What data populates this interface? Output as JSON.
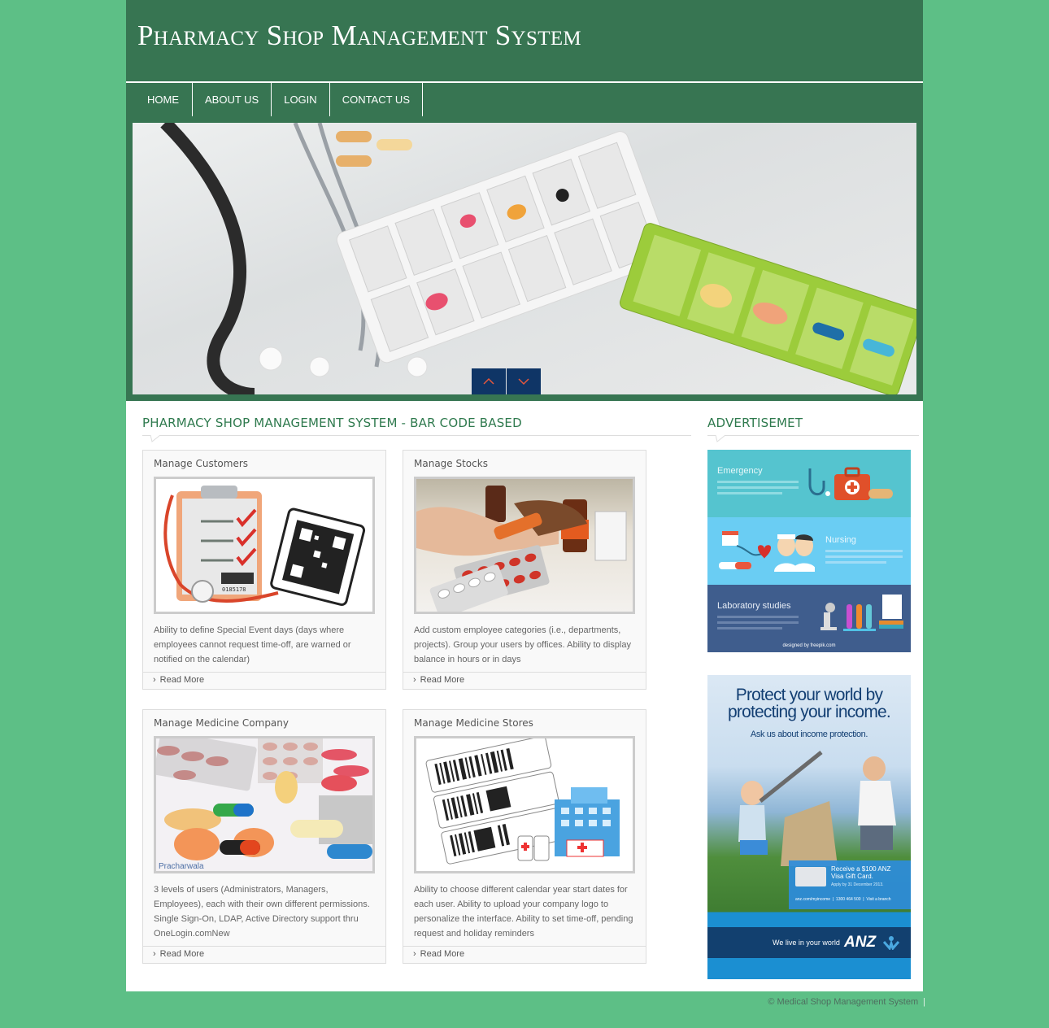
{
  "header": {
    "site_title": "Pharmacy Shop Management System"
  },
  "nav": {
    "items": [
      {
        "label": "HOME"
      },
      {
        "label": "ABOUT US"
      },
      {
        "label": "LOGIN"
      },
      {
        "label": "CONTACT US"
      }
    ]
  },
  "slider": {
    "prev_icon": "chevron-up-icon",
    "next_icon": "chevron-down-icon"
  },
  "main": {
    "section_title": "PHARMACY SHOP MANAGEMENT SYSTEM - BAR CODE BASED",
    "cards": [
      {
        "title": "Manage Customers",
        "text": "Ability to define Special Event days (days where employees cannot request time-off, are warned or notified on the calendar)",
        "more": "Read More",
        "image_label": "0185178"
      },
      {
        "title": "Manage Stocks",
        "text": "Add custom employee categories (i.e., departments, projects). Group your users by offices. Ability to display balance in hours or in days",
        "more": "Read More"
      },
      {
        "title": "Manage Medicine Company",
        "text": "3 levels of users (Administrators, Managers, Employees), each with their own different permissions. Single Sign-On, LDAP, Active Directory support thru OneLogin.comNew",
        "more": "Read More",
        "image_label": "Pracharwala"
      },
      {
        "title": "Manage Medicine Stores",
        "text": "Ability to choose different calendar year start dates for each user. Ability to upload your company logo to personalize the interface. Ability to set time-off, pending request and holiday reminders",
        "more": "Read More"
      }
    ]
  },
  "sidebar": {
    "title": "ADVERTISEMET",
    "ad1": {
      "panels": [
        {
          "label": "Emergency",
          "color": "#55c4cf"
        },
        {
          "label": "Nursing",
          "color": "#6acdf3"
        },
        {
          "label": "Laboratory studies",
          "color": "#3f5d8d"
        }
      ],
      "credit": "designed by freepik.com"
    },
    "ad2": {
      "headline": "Protect your world by protecting your income.",
      "subline": "Ask us about income protection.",
      "offer": "Receive a $100 ANZ Visa Gift Card.",
      "offer_note": "Apply by 31 December 2013.",
      "contact": "anz.com/myincome  |  1300 464 500  |  Visit a branch",
      "tagline": "We live in your world",
      "brand": "ANZ"
    }
  },
  "footer": {
    "copyright": "© Medical Shop Management System",
    "separator": "|"
  }
}
